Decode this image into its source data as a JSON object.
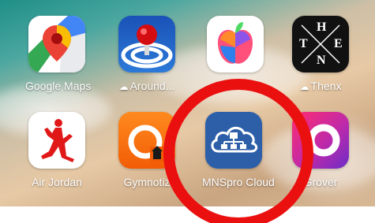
{
  "apps": [
    {
      "name": "Google Maps",
      "icon": "google-maps-icon",
      "cloud": false
    },
    {
      "name": "Around...",
      "icon": "around-icon",
      "cloud": true
    },
    {
      "name": "",
      "icon": "apple-fruit-icon",
      "cloud": false
    },
    {
      "name": "Thenx",
      "icon": "thenx-icon",
      "cloud": true
    },
    {
      "name": "Air Jordan",
      "icon": "air-jordan-icon",
      "cloud": false
    },
    {
      "name": "Gymnotiz",
      "icon": "gymnotize-icon",
      "cloud": false
    },
    {
      "name": "MNSpro Cloud",
      "icon": "mnspro-cloud-icon",
      "cloud": false
    },
    {
      "name": "Grover",
      "icon": "grover-icon",
      "cloud": false
    }
  ],
  "thenx_letters": {
    "t": "T",
    "h": "H",
    "e": "E",
    "n": "N"
  },
  "highlight": {
    "color": "#ea1010",
    "target": "MNSpro Cloud"
  }
}
